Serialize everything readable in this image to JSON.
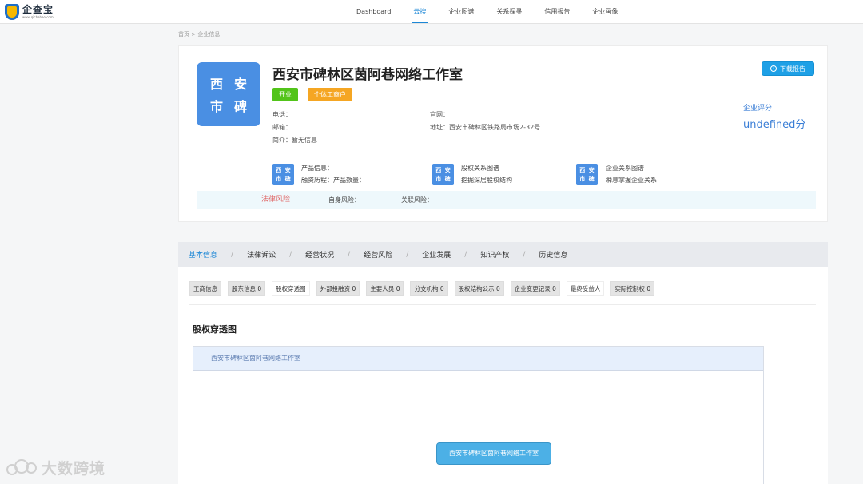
{
  "logo": {
    "name": "企查宝",
    "sub": "www.qichabao.com"
  },
  "nav": [
    {
      "label": "Dashboard",
      "active": false
    },
    {
      "label": "云搜",
      "active": true
    },
    {
      "label": "企业图谱",
      "active": false
    },
    {
      "label": "关系探寻",
      "active": false
    },
    {
      "label": "信用报告",
      "active": false
    },
    {
      "label": "企业画像",
      "active": false
    }
  ],
  "breadcrumb": {
    "home": "首页",
    "sep": ">",
    "current": "企业信息"
  },
  "company": {
    "avatar_chars": [
      "西",
      "安",
      "市",
      "碑"
    ],
    "name": "西安市碑林区茵阿巷网络工作室",
    "tags": [
      "开业",
      "个体工商户"
    ],
    "phone_label": "电话：",
    "email_label": "邮箱：",
    "intro_label": "简介：",
    "intro_value": "暂无信息",
    "website_label": "官网：",
    "address_label": "地址：",
    "address_value": "西安市碑林区铁路局市场2-32号",
    "download_label": "下载报告",
    "score_label": "企业评分",
    "score_value": "undefined分"
  },
  "mini_cards": [
    {
      "chars": [
        "西",
        "安",
        "市",
        "碑"
      ],
      "line1": "产品信息：",
      "line2": "融资历程：产品数量："
    },
    {
      "chars": [
        "西",
        "安",
        "市",
        "碑"
      ],
      "line1": "股权关系图谱",
      "line2": "挖掘深层股权结构"
    },
    {
      "chars": [
        "西",
        "安",
        "市",
        "碑"
      ],
      "line1": "企业关系图谱",
      "line2": "瞬息掌握企业关系"
    }
  ],
  "risk": {
    "law": "法律风险",
    "self": "自身风险：",
    "related": "关联风险："
  },
  "tabs": [
    "基本信息",
    "法律诉讼",
    "经营状况",
    "经营风险",
    "企业发展",
    "知识产权",
    "历史信息"
  ],
  "sep": "/",
  "subtabs": [
    {
      "label": "工商信息",
      "plain": false
    },
    {
      "label": "股东信息 0",
      "plain": false
    },
    {
      "label": "股权穿透图",
      "plain": true
    },
    {
      "label": "外部投融资 0",
      "plain": false
    },
    {
      "label": "主要人员 0",
      "plain": false
    },
    {
      "label": "分支机构 0",
      "plain": false
    },
    {
      "label": "股权结构公示 0",
      "plain": false
    },
    {
      "label": "企业变更记录 0",
      "plain": false
    },
    {
      "label": "最终受益人",
      "plain": true
    },
    {
      "label": "实际控制权 0",
      "plain": false
    }
  ],
  "section_title": "股权穿透图",
  "diagram": {
    "header": "西安市碑林区茵阿巷网络工作室",
    "node": "西安市碑林区茵阿巷网络工作室"
  },
  "watermark": "大数跨境"
}
